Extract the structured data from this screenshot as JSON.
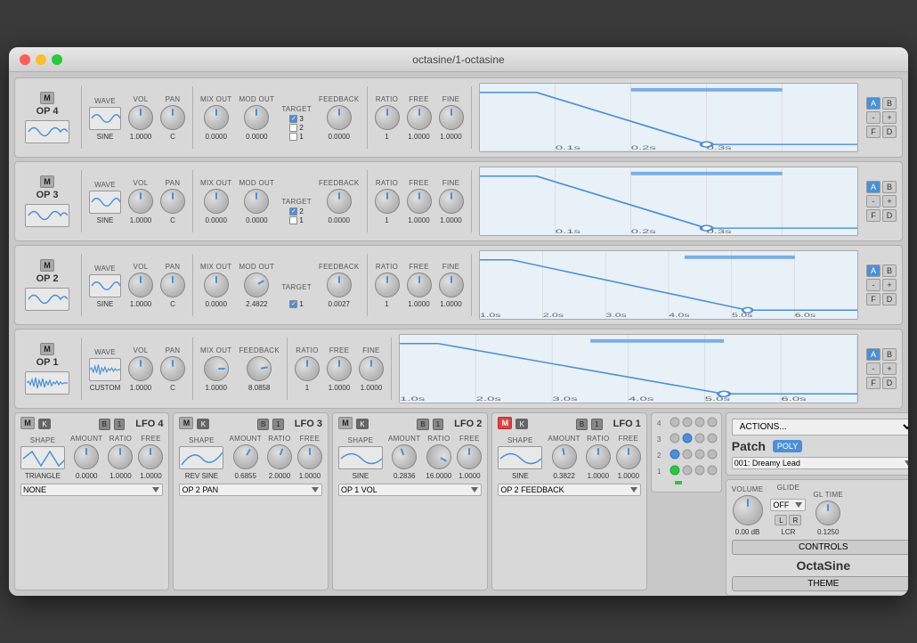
{
  "window": {
    "title": "octasine/1-octasine"
  },
  "ops": [
    {
      "id": "op4",
      "name": "OP 4",
      "wave": "SINE",
      "vol": "1.0000",
      "pan": "C",
      "mix_out": "0.0000",
      "mod_out": "0.0000",
      "feedback": "0.0000",
      "targets": [
        {
          "label": "3",
          "checked": true
        },
        {
          "label": "2",
          "checked": false
        },
        {
          "label": "1",
          "checked": false
        }
      ],
      "ratio": "1",
      "free": "1.0000",
      "fine": "1.0000",
      "env_times": [
        "0.1s",
        "0.2s",
        "0.3s"
      ],
      "env_type": "short"
    },
    {
      "id": "op3",
      "name": "OP 3",
      "wave": "SINE",
      "vol": "1.0000",
      "pan": "C",
      "mix_out": "0.0000",
      "mod_out": "0.0000",
      "feedback": "0.0000",
      "targets": [
        {
          "label": "2",
          "checked": true
        },
        {
          "label": "1",
          "checked": false
        }
      ],
      "ratio": "1",
      "free": "1.0000",
      "fine": "1.0000",
      "env_times": [
        "0.1s",
        "0.2s",
        "0.3s"
      ],
      "env_type": "short"
    },
    {
      "id": "op2",
      "name": "OP 2",
      "wave": "SINE",
      "vol": "1.0000",
      "pan": "C",
      "mix_out": "0.0000",
      "mod_out": "2.4822",
      "feedback": "0.0027",
      "targets": [
        {
          "label": "1",
          "checked": true
        }
      ],
      "ratio": "1",
      "free": "1.0000",
      "fine": "1.0000",
      "env_times": [
        "1.0s",
        "2.0s",
        "3.0s",
        "4.0s",
        "5.0s",
        "6.0s"
      ],
      "env_type": "long"
    },
    {
      "id": "op1",
      "name": "OP 1",
      "wave": "CUSTOM",
      "vol": "1.0000",
      "pan": "C",
      "mix_out": "1.0000",
      "mod_out": null,
      "feedback": "8.0858",
      "targets": null,
      "ratio": "1",
      "free": "1.0000",
      "fine": "1.0000",
      "env_times": [
        "1.0s",
        "2.0s",
        "3.0s",
        "4.0s",
        "5.0s",
        "6.0s"
      ],
      "env_type": "long"
    }
  ],
  "lfos": [
    {
      "id": "lfo4",
      "name": "LFO 4",
      "shape": "TRIANGLE",
      "amount": "0.0000",
      "ratio": "1.0000",
      "free": "1.0000",
      "target": "NONE",
      "wave_type": "triangle"
    },
    {
      "id": "lfo3",
      "name": "LFO 3",
      "shape": "REV SINE",
      "amount": "0.6855",
      "ratio": "2.0000",
      "free": "1.0000",
      "target": "OP 2 PAN",
      "wave_type": "rev_sine"
    },
    {
      "id": "lfo2",
      "name": "LFO 2",
      "shape": "SINE",
      "amount": "0.2836",
      "ratio": "16.0000",
      "free": "1.0000",
      "target": "OP 1 VOL",
      "wave_type": "sine"
    },
    {
      "id": "lfo1",
      "name": "LFO 1",
      "shape": "SINE",
      "amount": "0.3822",
      "ratio": "1.0000",
      "free": "1.0000",
      "target": "OP 2 FEEDBACK",
      "wave_type": "sine",
      "m_red": true
    }
  ],
  "controls": {
    "volume_label": "VOLUME",
    "volume_val": "0.00 dB",
    "glide_label": "GLIDE",
    "glide_val": "OFF",
    "gl_time_label": "GL TIME",
    "gl_time_val": "0.1250",
    "lcr": "LCR",
    "controls_btn": "CONTROLS",
    "octasine_label": "OctaSine",
    "theme_btn": "THEME"
  },
  "patch": {
    "actions_label": "ACTIONS...",
    "patch_label": "Patch",
    "poly_label": "POLY",
    "patch_name": "001: Dreamy Lead"
  },
  "labels": {
    "wave": "WAVE",
    "vol": "VOL",
    "pan": "PAN",
    "mix_out": "MIX OUT",
    "mod_out": "MOD OUT",
    "target": "TARGET",
    "feedback": "FEEDBACK",
    "ratio": "RATIO",
    "free": "FREE",
    "fine": "FINE",
    "shape": "SHAPE",
    "amount": "AMOUNT"
  },
  "env_buttons": {
    "a": "A",
    "b": "B",
    "minus": "-",
    "plus": "+",
    "f": "F",
    "d": "D"
  }
}
